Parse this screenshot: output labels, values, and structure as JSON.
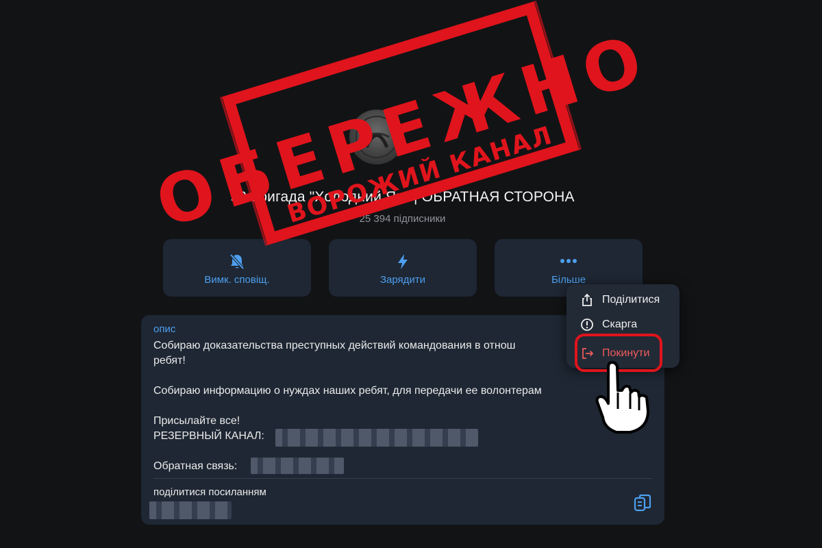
{
  "channel": {
    "title": "93 бригада \"Холодний Яр\" | ОБРАТНАЯ СТОРОНА",
    "subscribers": "25 394 підписники"
  },
  "actions": [
    {
      "label": "Вимк. сповіщ.",
      "icon": "bell-off-icon"
    },
    {
      "label": "Зарядити",
      "icon": "lightning-icon"
    },
    {
      "label": "Більше",
      "icon": "more-dots-icon"
    }
  ],
  "menu": {
    "items": [
      {
        "label": "Поділитися",
        "icon": "share-icon"
      },
      {
        "label": "Скарга",
        "icon": "alert-icon"
      },
      {
        "label": "Покинути",
        "icon": "exit-icon"
      }
    ]
  },
  "description": {
    "heading": "опис",
    "body": "Собираю доказательства преступных действий командования в отнош\nребят!\n\nСобираю информацию о нуждах наших ребят, для передачи ее волонтерам\n\nПрисылайте все!\nРЕЗЕРВНЫЙ КАНАЛ:\n\nОбратная связь:",
    "share_link_label": "поділитися посиланням"
  },
  "stamp": {
    "main_text": "ОБЕРЕЖНО",
    "sub_text": "ВОРОЖИЙ КАНАЛ"
  },
  "colors": {
    "accent": "#4e9ff0",
    "danger": "#ee5b5b",
    "stamp_red": "#e0141c",
    "card_bg": "#1e2733",
    "page_bg": "#121315"
  }
}
